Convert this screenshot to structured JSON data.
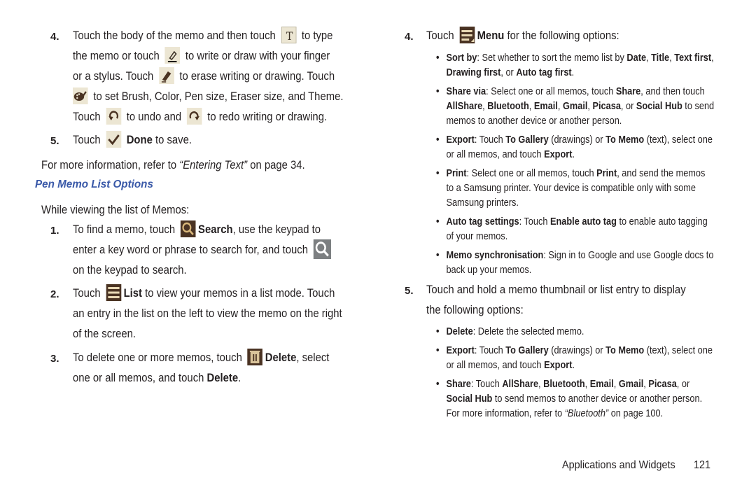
{
  "left": {
    "step4": {
      "number": "4.",
      "lines": [
        {
          "a": "Touch the body of the memo and then touch",
          "b": "to type"
        },
        {
          "a": "the memo or touch",
          "b": "to write or draw with your finger"
        },
        {
          "a": "or a stylus. Touch",
          "b": "to erase writing or drawing. Touch"
        },
        {
          "b": "to set Brush, Color, Pen size, Eraser size, and Theme."
        },
        {
          "a": "Touch",
          "b": "to undo and",
          "c": "to redo writing or drawing."
        }
      ],
      "icons": [
        "text-mode-icon",
        "pen-icon",
        "eraser-icon",
        "settings-palette-icon",
        "undo-icon",
        "redo-icon"
      ]
    },
    "step5": {
      "number": "5.",
      "touch": "Touch",
      "done": "Done",
      "rest": "to save."
    },
    "more_info": {
      "prefix": "For more information, refer to",
      "ref": "“Entering Text”",
      "suffix": "on page 34."
    },
    "heading": "Pen Memo List Options",
    "intro": "While viewing the list of Memos:",
    "list_steps": [
      {
        "number": "1.",
        "l1a": "To find a memo, touch",
        "l1b": "Search",
        "l1c": ", use the keypad to",
        "l2": "enter a key word or phrase to search for, and touch",
        "l3": "on the keypad to search."
      },
      {
        "number": "2.",
        "l1a": "Touch",
        "l1b": "List",
        "l1c": "to view your memos in a list mode. Touch",
        "l2": "an entry in the list on the left to view the memo on the right",
        "l3": "of the screen."
      },
      {
        "number": "3.",
        "l1a": "To delete one or more memos, touch",
        "l1b": "Delete",
        "l1c": ", select",
        "l2a": "one or all memos, and touch",
        "l2b": "Delete",
        "l2c": "."
      }
    ]
  },
  "right": {
    "step4": {
      "number": "4.",
      "touch": "Touch",
      "menu": "Menu",
      "rest": "for the following options:"
    },
    "menu_options": [
      {
        "rows": [
          [
            {
              "t": "Sort by",
              "b": true
            },
            {
              "t": ": Set whether to sort the memo list by "
            },
            {
              "t": "Date",
              "b": true
            },
            {
              "t": ", "
            },
            {
              "t": "Title",
              "b": true
            },
            {
              "t": ", "
            },
            {
              "t": "Text first",
              "b": true
            },
            {
              "t": ","
            }
          ],
          [
            {
              "t": "Drawing first",
              "b": true
            },
            {
              "t": ", or "
            },
            {
              "t": "Auto tag first",
              "b": true
            },
            {
              "t": "."
            }
          ]
        ]
      },
      {
        "rows": [
          [
            {
              "t": "Share via",
              "b": true
            },
            {
              "t": ": Select one or all memos, touch "
            },
            {
              "t": "Share",
              "b": true
            },
            {
              "t": ", and then touch"
            }
          ],
          [
            {
              "t": "AllShare",
              "b": true
            },
            {
              "t": ", "
            },
            {
              "t": "Bluetooth",
              "b": true
            },
            {
              "t": ", "
            },
            {
              "t": "Email",
              "b": true
            },
            {
              "t": ", "
            },
            {
              "t": "Gmail",
              "b": true
            },
            {
              "t": ", "
            },
            {
              "t": "Picasa",
              "b": true
            },
            {
              "t": ", or "
            },
            {
              "t": "Social Hub",
              "b": true
            },
            {
              "t": " to send"
            }
          ],
          [
            {
              "t": "memos to another device or another person."
            }
          ]
        ]
      },
      {
        "rows": [
          [
            {
              "t": "Export",
              "b": true
            },
            {
              "t": ": Touch "
            },
            {
              "t": "To Gallery",
              "b": true
            },
            {
              "t": " (drawings) or "
            },
            {
              "t": "To Memo",
              "b": true
            },
            {
              "t": " (text), select one"
            }
          ],
          [
            {
              "t": "or all memos, and touch "
            },
            {
              "t": "Export",
              "b": true
            },
            {
              "t": "."
            }
          ]
        ]
      },
      {
        "rows": [
          [
            {
              "t": "Print",
              "b": true
            },
            {
              "t": ": Select one or all memos, touch "
            },
            {
              "t": "Print",
              "b": true
            },
            {
              "t": ", and send the memos"
            }
          ],
          [
            {
              "t": "to a Samsung printer. Your device is compatible only with some"
            }
          ],
          [
            {
              "t": "Samsung printers."
            }
          ]
        ]
      },
      {
        "rows": [
          [
            {
              "t": "Auto tag settings",
              "b": true
            },
            {
              "t": ": Touch "
            },
            {
              "t": "Enable auto tag",
              "b": true
            },
            {
              "t": " to enable auto tagging"
            }
          ],
          [
            {
              "t": "of your memos."
            }
          ]
        ]
      },
      {
        "rows": [
          [
            {
              "t": "Memo synchronisation",
              "b": true
            },
            {
              "t": ": Sign in to Google and use Google docs to"
            }
          ],
          [
            {
              "t": "back up your memos."
            }
          ]
        ]
      }
    ],
    "step5": {
      "number": "5.",
      "l1": "Touch and hold a memo thumbnail or list entry to display",
      "l2": "the following options:"
    },
    "hold_options": [
      {
        "rows": [
          [
            {
              "t": "Delete",
              "b": true
            },
            {
              "t": ": Delete the selected memo."
            }
          ]
        ]
      },
      {
        "rows": [
          [
            {
              "t": "Export",
              "b": true
            },
            {
              "t": ": Touch "
            },
            {
              "t": "To Gallery",
              "b": true
            },
            {
              "t": " (drawings) or "
            },
            {
              "t": "To Memo",
              "b": true
            },
            {
              "t": " (text), select one"
            }
          ],
          [
            {
              "t": "or all memos, and touch "
            },
            {
              "t": "Export",
              "b": true
            },
            {
              "t": "."
            }
          ]
        ]
      },
      {
        "rows": [
          [
            {
              "t": "Share",
              "b": true
            },
            {
              "t": ": Touch "
            },
            {
              "t": "AllShare",
              "b": true
            },
            {
              "t": ", "
            },
            {
              "t": "Bluetooth",
              "b": true
            },
            {
              "t": ", "
            },
            {
              "t": "Email",
              "b": true
            },
            {
              "t": ", "
            },
            {
              "t": "Gmail",
              "b": true
            },
            {
              "t": ", "
            },
            {
              "t": "Picasa",
              "b": true
            },
            {
              "t": ", or"
            }
          ],
          [
            {
              "t": "Social Hub",
              "b": true
            },
            {
              "t": " to send memos to another device or another person."
            }
          ],
          [
            {
              "t": "For more information, refer to "
            },
            {
              "t": "“Bluetooth”",
              "i": true
            },
            {
              "t": " on page 100."
            }
          ]
        ]
      }
    ],
    "bullet_char": "•"
  },
  "footer": {
    "section": "Applications and Widgets",
    "page": "121"
  },
  "colors": {
    "heading": "#3a59a8",
    "icon_light_bg": "#ece6d3",
    "icon_dark_bg": "#4a3323",
    "icon_glyph": "#4a3323"
  }
}
